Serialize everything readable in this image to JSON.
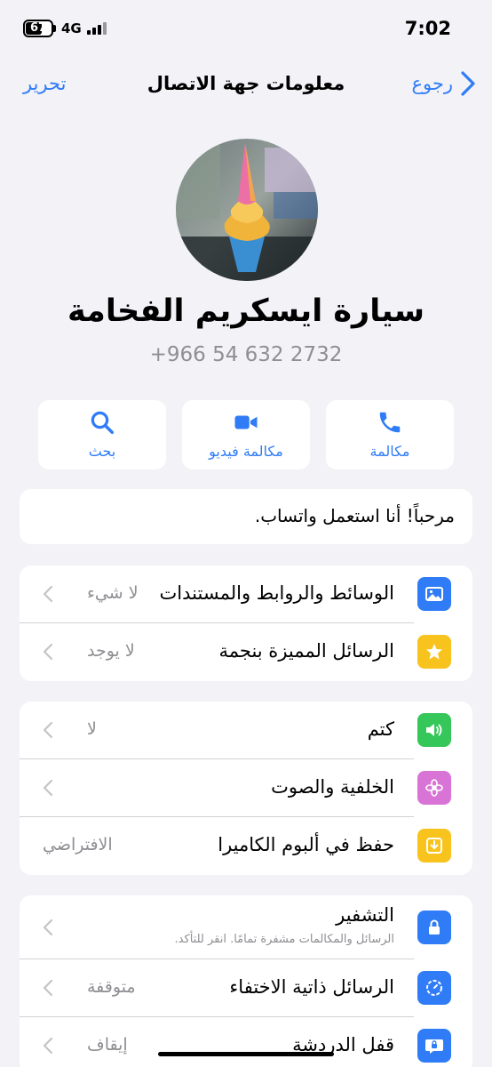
{
  "status_bar": {
    "battery": "67",
    "battery_level": 0.67,
    "network": "4G",
    "time": "7:02"
  },
  "nav": {
    "back_label": "رجوع",
    "title": "معلومات جهة الاتصال",
    "edit_label": "تحرير"
  },
  "contact": {
    "name": "سيارة ايسكريم الفخامة",
    "phone": "+966 54 632 2732"
  },
  "actions": {
    "call": "مكالمة",
    "video": "مكالمة فيديو",
    "search": "بحث"
  },
  "about": "مرحباً! أنا استعمل واتساب.",
  "media_section": {
    "media": {
      "label": "الوسائط والروابط والمستندات",
      "value": "لا شيء",
      "icon": "photo-icon",
      "color": "#2f7cf6"
    },
    "starred": {
      "label": "الرسائل المميزة بنجمة",
      "value": "لا يوجد",
      "icon": "star-icon",
      "color": "#f7c31c"
    }
  },
  "settings_section": {
    "mute": {
      "label": "كتم",
      "value": "لا",
      "icon": "speaker-icon",
      "color": "#35c759"
    },
    "wallpaper": {
      "label": "الخلفية والصوت",
      "icon": "flower-icon",
      "color": "#d874d6"
    },
    "save_to_camera": {
      "label": "حفظ في ألبوم الكاميرا",
      "value": "الافتراضي",
      "icon": "save-icon",
      "color": "#f7c31c"
    }
  },
  "privacy_section": {
    "encryption": {
      "label": "التشفير",
      "sub": "الرسائل والمكالمات مشفرة تمامًا. انقر للتأكد.",
      "icon": "lock-icon",
      "color": "#2f7cf6"
    },
    "disappearing": {
      "label": "الرسائل ذاتية الاختفاء",
      "value": "متوقفة",
      "icon": "timer-icon",
      "color": "#2f7cf6"
    },
    "chat_lock": {
      "label": "قفل الدردشة",
      "value": "إيقاف",
      "icon": "chat-lock-icon",
      "color": "#2f7cf6"
    }
  }
}
